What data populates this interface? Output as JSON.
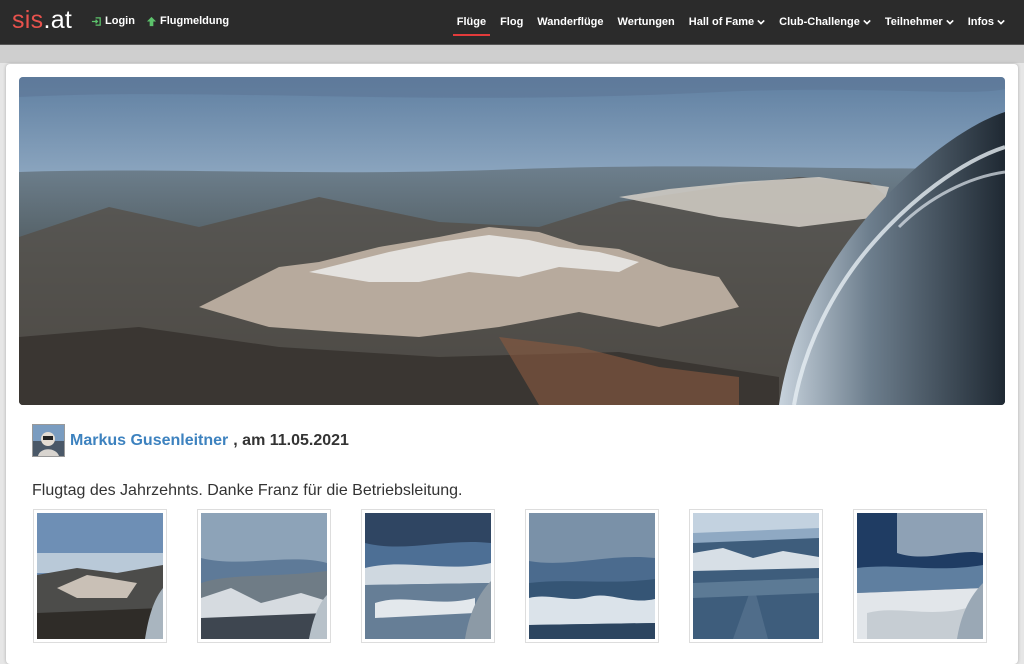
{
  "header": {
    "logo_prefix": "sis",
    "logo_suffix": ".at",
    "login_label": "Login",
    "flugmeldung_label": "Flugmeldung",
    "nav": [
      {
        "label": "Flüge",
        "active": true,
        "dropdown": false
      },
      {
        "label": "Flog",
        "active": false,
        "dropdown": false
      },
      {
        "label": "Wanderflüge",
        "active": false,
        "dropdown": false
      },
      {
        "label": "Wertungen",
        "active": false,
        "dropdown": false
      },
      {
        "label": "Hall of Fame",
        "active": false,
        "dropdown": true
      },
      {
        "label": "Club-Challenge",
        "active": false,
        "dropdown": true
      },
      {
        "label": "Teilnehmer",
        "active": false,
        "dropdown": true
      },
      {
        "label": "Infos",
        "active": false,
        "dropdown": true
      }
    ]
  },
  "post": {
    "author": "Markus Gusenleitner",
    "date_text": ", am 11.05.2021",
    "description": "Flugtag des Jahrzehnts. Danke Franz für die Betriebsleitung."
  },
  "colors": {
    "brand_red": "#e8524d",
    "link_blue": "#3d82bf",
    "nav_bg": "#2b2b2b",
    "active_underline": "#e23b3b"
  },
  "thumbnails_count": 6
}
